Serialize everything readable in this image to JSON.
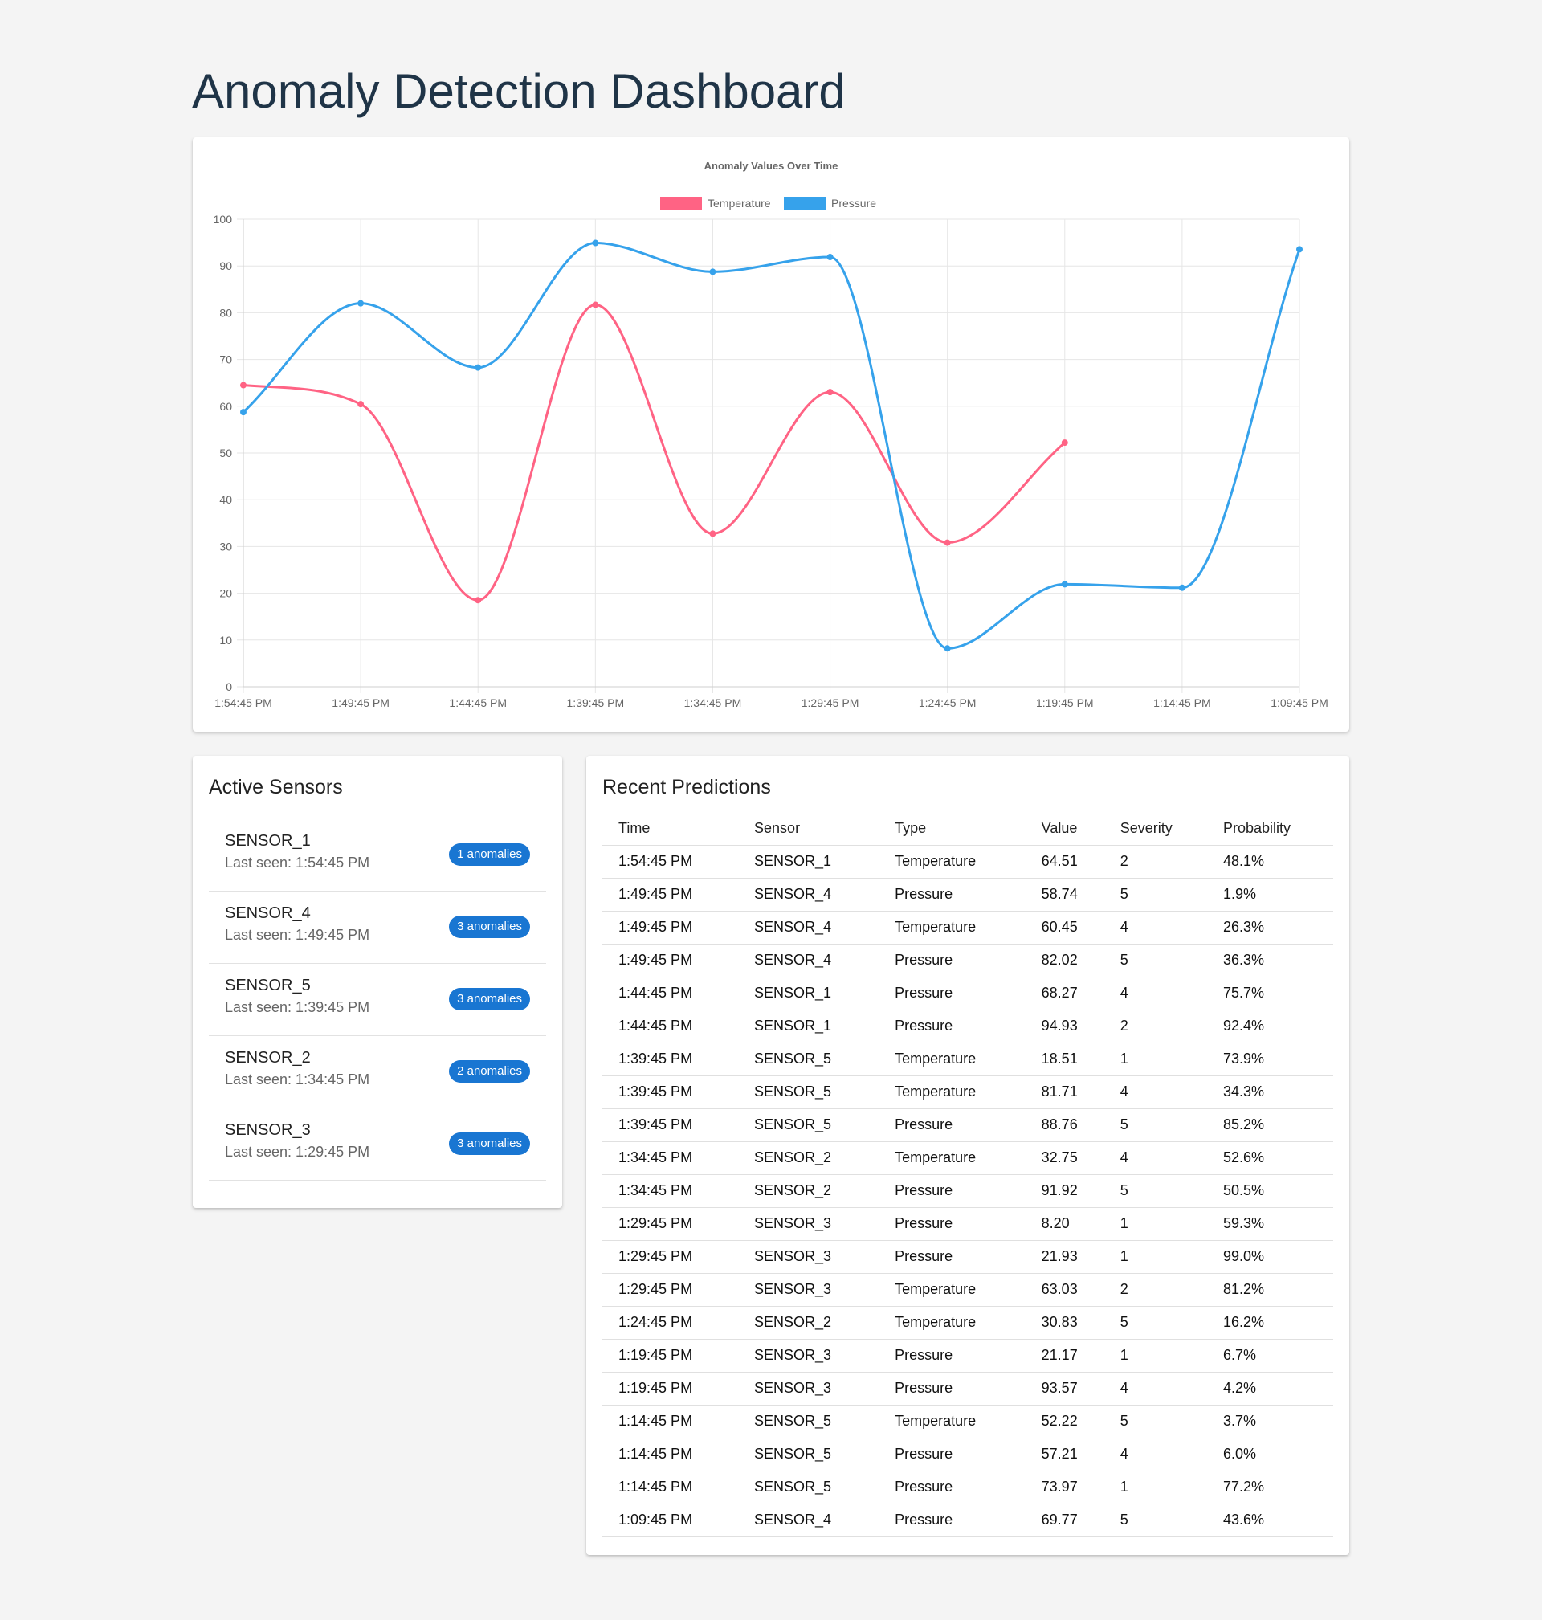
{
  "page": {
    "title": "Anomaly Detection Dashboard"
  },
  "chart_data": {
    "type": "line",
    "title": "Anomaly Values Over Time",
    "xlabel": "",
    "ylabel": "",
    "categories": [
      "1:54:45 PM",
      "1:49:45 PM",
      "1:44:45 PM",
      "1:39:45 PM",
      "1:34:45 PM",
      "1:29:45 PM",
      "1:24:45 PM",
      "1:19:45 PM",
      "1:14:45 PM",
      "1:09:45 PM"
    ],
    "ylim": [
      0,
      100
    ],
    "yticks": [
      0,
      10,
      20,
      30,
      40,
      50,
      60,
      70,
      80,
      90,
      100
    ],
    "grid": true,
    "legend_position": "top",
    "series": [
      {
        "name": "Temperature",
        "color": "#ff6384",
        "values": [
          64.51,
          60.45,
          18.51,
          81.71,
          32.75,
          63.03,
          30.83,
          52.22,
          null,
          null
        ]
      },
      {
        "name": "Pressure",
        "color": "#36a2eb",
        "values": [
          58.74,
          82.02,
          68.27,
          94.93,
          88.76,
          91.92,
          8.2,
          21.93,
          21.17,
          93.57
        ]
      }
    ]
  },
  "sensors": {
    "title": "Active Sensors",
    "last_seen_prefix": "Last seen: ",
    "items": [
      {
        "name": "SENSOR_1",
        "last_seen": "Last seen: 1:54:45 PM",
        "badge": "1 anomalies"
      },
      {
        "name": "SENSOR_4",
        "last_seen": "Last seen: 1:49:45 PM",
        "badge": "3 anomalies"
      },
      {
        "name": "SENSOR_5",
        "last_seen": "Last seen: 1:39:45 PM",
        "badge": "3 anomalies"
      },
      {
        "name": "SENSOR_2",
        "last_seen": "Last seen: 1:34:45 PM",
        "badge": "2 anomalies"
      },
      {
        "name": "SENSOR_3",
        "last_seen": "Last seen: 1:29:45 PM",
        "badge": "3 anomalies"
      }
    ]
  },
  "predictions": {
    "title": "Recent Predictions",
    "columns": [
      "Time",
      "Sensor",
      "Type",
      "Value",
      "Severity",
      "Probability"
    ],
    "rows": [
      [
        "1:54:45 PM",
        "SENSOR_1",
        "Temperature",
        "64.51",
        "2",
        "48.1%"
      ],
      [
        "1:49:45 PM",
        "SENSOR_4",
        "Pressure",
        "58.74",
        "5",
        "1.9%"
      ],
      [
        "1:49:45 PM",
        "SENSOR_4",
        "Temperature",
        "60.45",
        "4",
        "26.3%"
      ],
      [
        "1:49:45 PM",
        "SENSOR_4",
        "Pressure",
        "82.02",
        "5",
        "36.3%"
      ],
      [
        "1:44:45 PM",
        "SENSOR_1",
        "Pressure",
        "68.27",
        "4",
        "75.7%"
      ],
      [
        "1:44:45 PM",
        "SENSOR_1",
        "Pressure",
        "94.93",
        "2",
        "92.4%"
      ],
      [
        "1:39:45 PM",
        "SENSOR_5",
        "Temperature",
        "18.51",
        "1",
        "73.9%"
      ],
      [
        "1:39:45 PM",
        "SENSOR_5",
        "Temperature",
        "81.71",
        "4",
        "34.3%"
      ],
      [
        "1:39:45 PM",
        "SENSOR_5",
        "Pressure",
        "88.76",
        "5",
        "85.2%"
      ],
      [
        "1:34:45 PM",
        "SENSOR_2",
        "Temperature",
        "32.75",
        "4",
        "52.6%"
      ],
      [
        "1:34:45 PM",
        "SENSOR_2",
        "Pressure",
        "91.92",
        "5",
        "50.5%"
      ],
      [
        "1:29:45 PM",
        "SENSOR_3",
        "Pressure",
        "8.20",
        "1",
        "59.3%"
      ],
      [
        "1:29:45 PM",
        "SENSOR_3",
        "Pressure",
        "21.93",
        "1",
        "99.0%"
      ],
      [
        "1:29:45 PM",
        "SENSOR_3",
        "Temperature",
        "63.03",
        "2",
        "81.2%"
      ],
      [
        "1:24:45 PM",
        "SENSOR_2",
        "Temperature",
        "30.83",
        "5",
        "16.2%"
      ],
      [
        "1:19:45 PM",
        "SENSOR_3",
        "Pressure",
        "21.17",
        "1",
        "6.7%"
      ],
      [
        "1:19:45 PM",
        "SENSOR_3",
        "Pressure",
        "93.57",
        "4",
        "4.2%"
      ],
      [
        "1:14:45 PM",
        "SENSOR_5",
        "Temperature",
        "52.22",
        "5",
        "3.7%"
      ],
      [
        "1:14:45 PM",
        "SENSOR_5",
        "Pressure",
        "57.21",
        "4",
        "6.0%"
      ],
      [
        "1:14:45 PM",
        "SENSOR_5",
        "Pressure",
        "73.97",
        "1",
        "77.2%"
      ],
      [
        "1:09:45 PM",
        "SENSOR_4",
        "Pressure",
        "69.77",
        "5",
        "43.6%"
      ]
    ]
  }
}
